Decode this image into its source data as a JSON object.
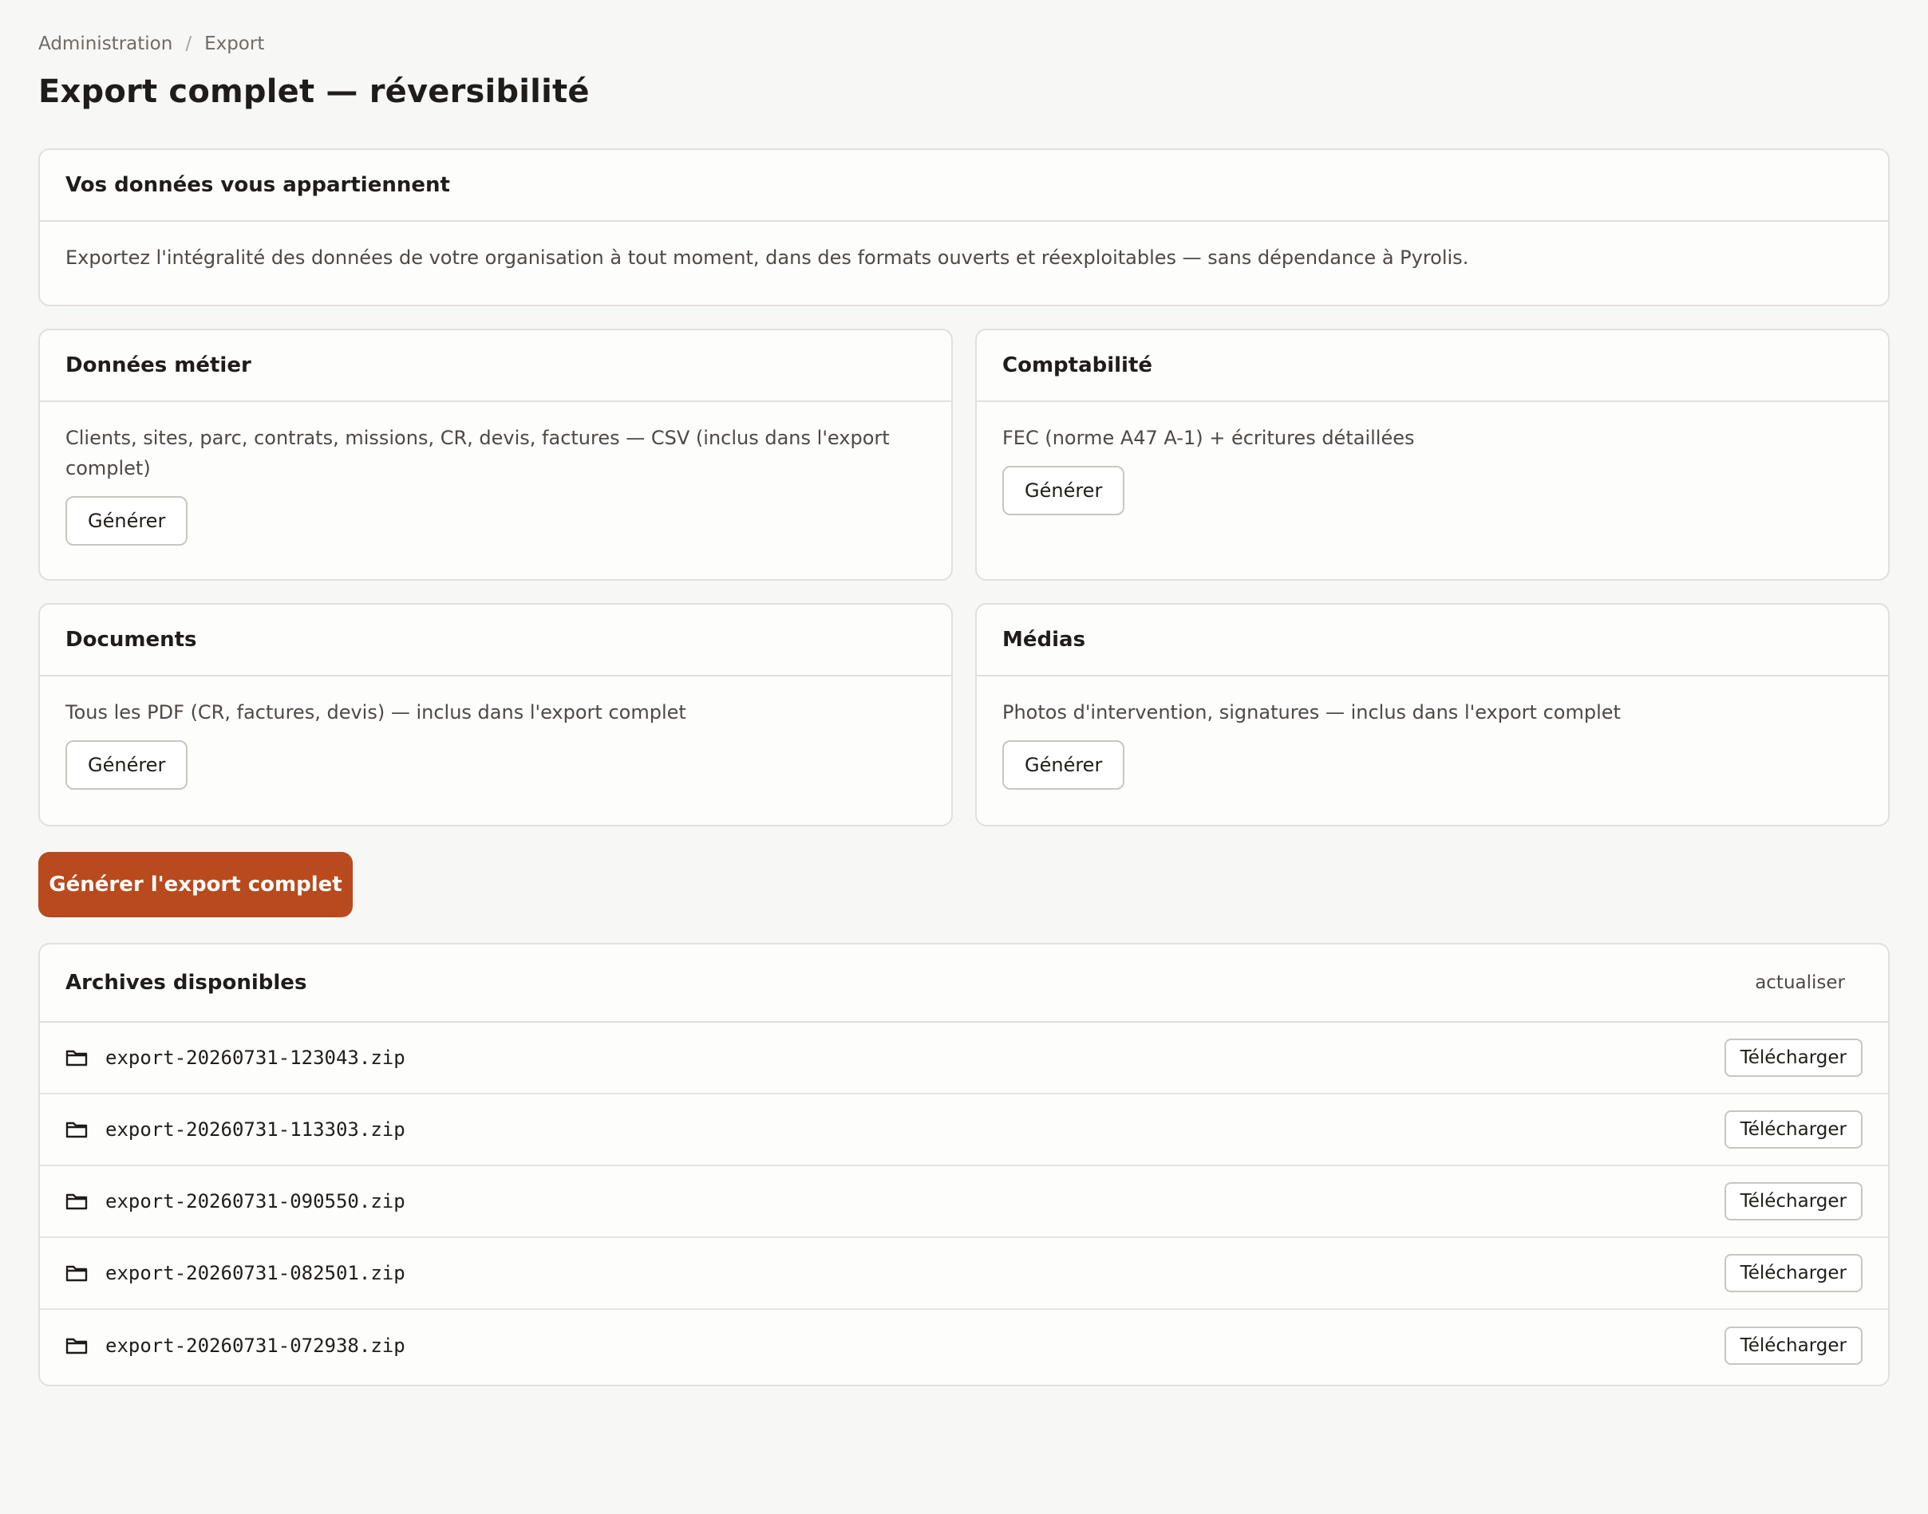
{
  "breadcrumb": {
    "items": [
      "Administration",
      "Export"
    ],
    "separator": "/"
  },
  "page": {
    "title": "Export complet — réversibilité"
  },
  "intro": {
    "title": "Vos données vous appartiennent",
    "text": "Exportez l'intégralité des données de votre organisation à tout moment, dans des formats ouverts et réexploitables — sans dépendance à Pyrolis."
  },
  "sections": {
    "metier": {
      "title": "Données métier",
      "text": "Clients, sites, parc, contrats, missions, CR, devis, factures — CSV (inclus dans l'export complet)",
      "button": "Générer"
    },
    "compta": {
      "title": "Comptabilité",
      "text": "FEC (norme A47 A-1) + écritures détaillées",
      "button": "Générer"
    },
    "documents": {
      "title": "Documents",
      "text": "Tous les PDF (CR, factures, devis) — inclus dans l'export complet",
      "button": "Générer"
    },
    "medias": {
      "title": "Médias",
      "text": "Photos d'intervention, signatures — inclus dans l'export complet",
      "button": "Générer"
    }
  },
  "primary_action": {
    "label": "Générer l'export complet",
    "color": "#b84a1e"
  },
  "archives": {
    "title": "Archives disponibles",
    "refresh": "actualiser",
    "download_label": "Télécharger",
    "icon": "folder-icon",
    "items": [
      "export-20260731-123043.zip",
      "export-20260731-113303.zip",
      "export-20260731-090550.zip",
      "export-20260731-082501.zip",
      "export-20260731-072938.zip"
    ]
  }
}
